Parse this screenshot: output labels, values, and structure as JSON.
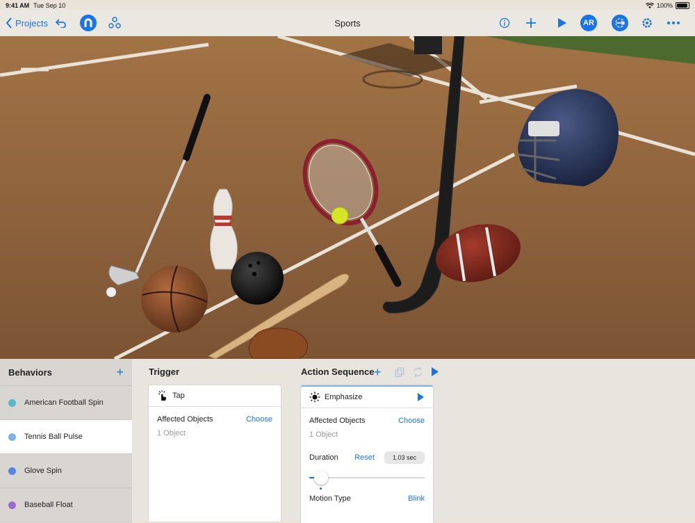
{
  "status": {
    "time": "9:41 AM",
    "date": "Tue Sep 10",
    "battery": "100%"
  },
  "nav": {
    "back_label": "Projects",
    "title": "Sports",
    "ar_label": "AR"
  },
  "behaviors": {
    "title": "Behaviors",
    "items": [
      {
        "label": "American Football Spin",
        "color": "#59b8c9"
      },
      {
        "label": "Tennis Ball Pulse",
        "color": "#7fb2e6"
      },
      {
        "label": "Glove Spin",
        "color": "#5b85e8"
      },
      {
        "label": "Baseball Float",
        "color": "#9a6bd1"
      }
    ]
  },
  "trigger": {
    "title": "Trigger",
    "name": "Tap",
    "affected_label": "Affected Objects",
    "choose": "Choose",
    "count": "1 Object"
  },
  "action": {
    "title": "Action Sequence",
    "name": "Emphasize",
    "affected_label": "Affected Objects",
    "choose": "Choose",
    "count": "1 Object",
    "duration_label": "Duration",
    "reset": "Reset",
    "duration_value": "1.03 sec",
    "duration_fraction": 0.08,
    "motion_label": "Motion Type",
    "motion_value": "Blink"
  },
  "colors": {
    "accent": "#1a73e8"
  }
}
